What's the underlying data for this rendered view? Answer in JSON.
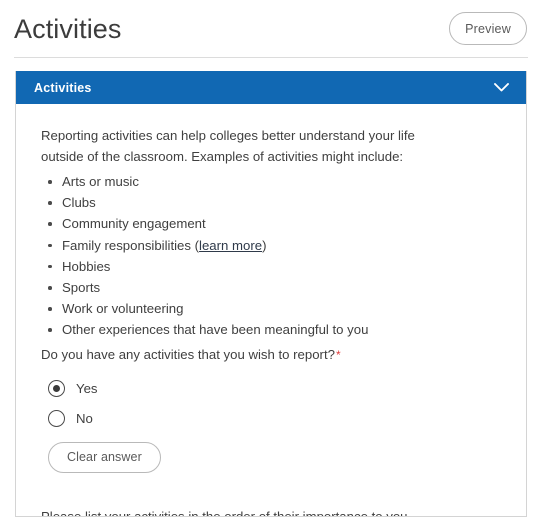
{
  "header": {
    "title": "Activities",
    "preview_label": "Preview"
  },
  "card": {
    "header_title": "Activities",
    "collapse_icon": "chevron-down-icon",
    "intro": "Reporting activities can help colleges better understand your life outside of the classroom. Examples of activities might include:",
    "bullets": [
      {
        "text": "Arts or music",
        "link": null,
        "suffix": null
      },
      {
        "text": "Clubs",
        "link": null,
        "suffix": null
      },
      {
        "text": "Community engagement",
        "link": null,
        "suffix": null
      },
      {
        "text": "Family responsibilities (",
        "link": "learn more",
        "suffix": ")"
      },
      {
        "text": "Hobbies",
        "link": null,
        "suffix": null
      },
      {
        "text": "Sports",
        "link": null,
        "suffix": null
      },
      {
        "text": "Work or volunteering",
        "link": null,
        "suffix": null
      },
      {
        "text": "Other experiences that have been meaningful to you",
        "link": null,
        "suffix": null
      }
    ],
    "question": {
      "text": "Do you have any activities that you wish to report?",
      "required_marker": "*",
      "options": [
        {
          "label": "Yes",
          "selected": true
        },
        {
          "label": "No",
          "selected": false
        }
      ],
      "clear_label": "Clear answer"
    },
    "footer_note": "Please list your activities in the order of their importance to you."
  },
  "colors": {
    "accent_blue": "#1168b3",
    "required_red": "#e03b3b",
    "text": "#3f3f3f",
    "border": "#d4d4d4"
  }
}
